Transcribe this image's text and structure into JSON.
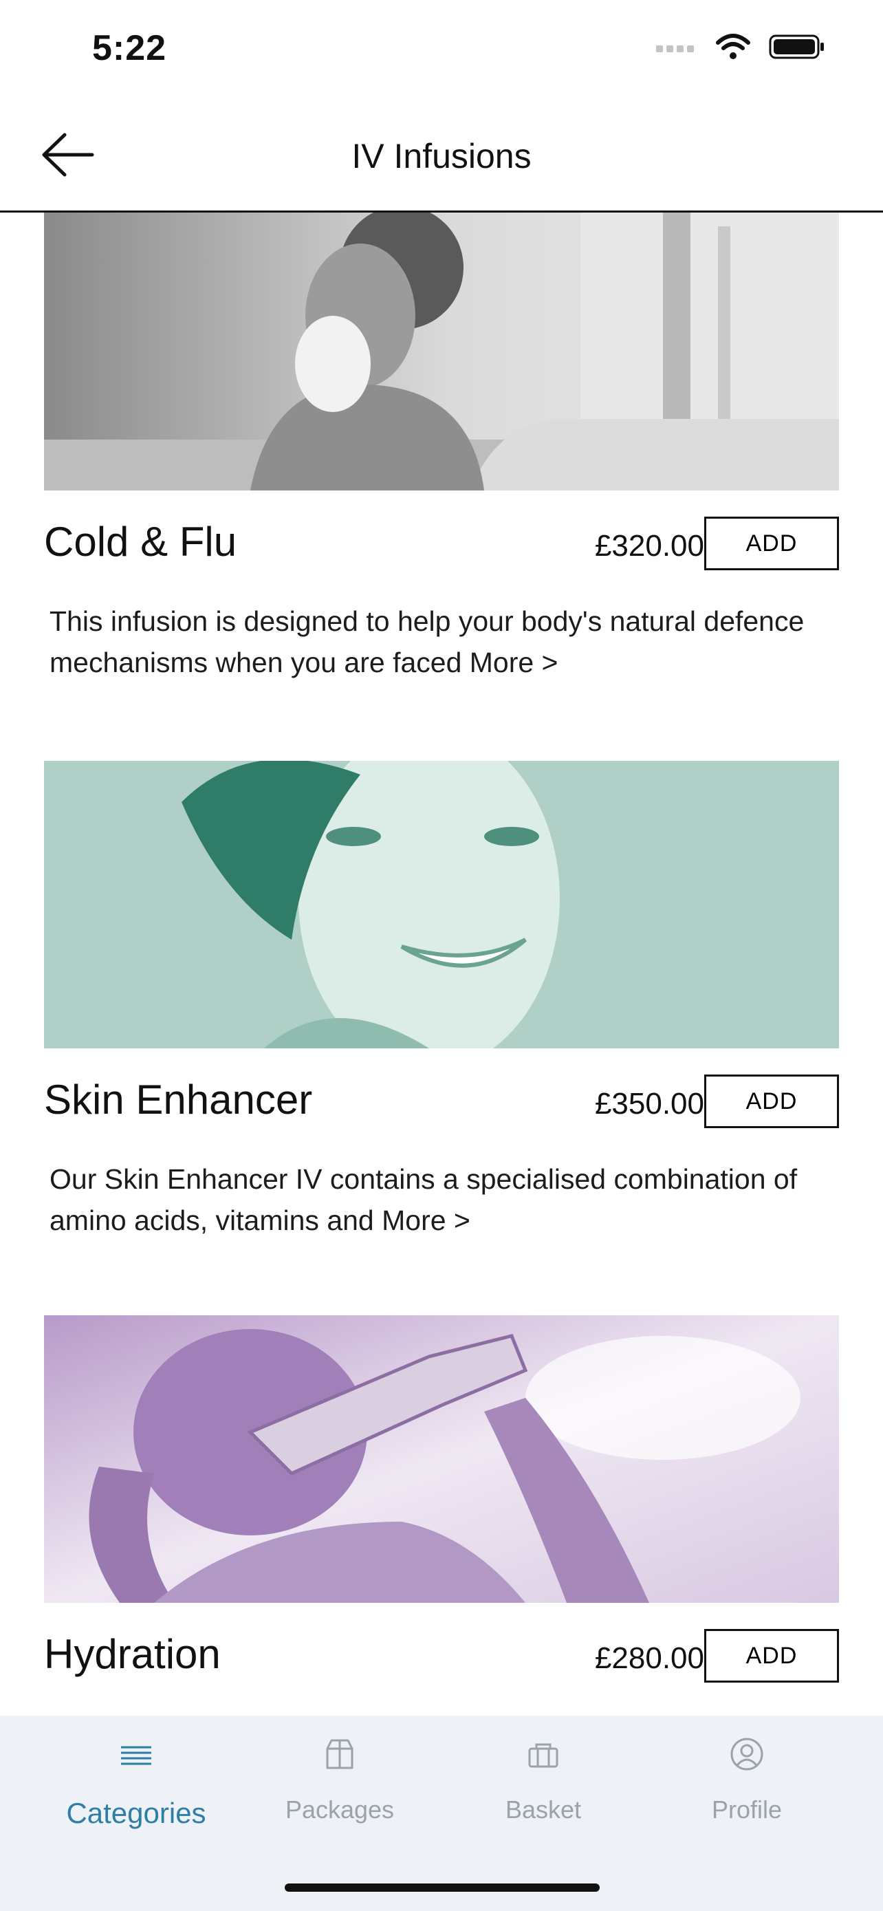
{
  "status": {
    "time": "5:22"
  },
  "nav": {
    "title": "IV Infusions"
  },
  "products": [
    {
      "name": "Cold & Flu",
      "price": "£320.00",
      "add_label": "ADD",
      "description": "This infusion is designed to help your body's natural defence mechanisms when you are faced More >",
      "image": "woman-blowing-nose-photo",
      "tint": "#9a9a9a"
    },
    {
      "name": "Skin Enhancer",
      "price": "£350.00",
      "add_label": "ADD",
      "description": "Our Skin Enhancer IV contains a specialised combination of amino acids, vitamins and More >",
      "image": "smiling-woman-photo",
      "tint": "#6fb3a1"
    },
    {
      "name": "Hydration",
      "price": "£280.00",
      "add_label": "ADD",
      "image": "woman-drinking-water-photo",
      "tint": "#a98bbd"
    }
  ],
  "tabs": [
    {
      "label": "Categories",
      "icon": "list-icon",
      "active": true
    },
    {
      "label": "Packages",
      "icon": "package-icon",
      "active": false
    },
    {
      "label": "Basket",
      "icon": "basket-icon",
      "active": false
    },
    {
      "label": "Profile",
      "icon": "profile-icon",
      "active": false
    }
  ],
  "colors": {
    "accent": "#2e7ea6",
    "tab_bar_bg": "#eef2f6",
    "inactive_tab": "#9aa2aa"
  }
}
